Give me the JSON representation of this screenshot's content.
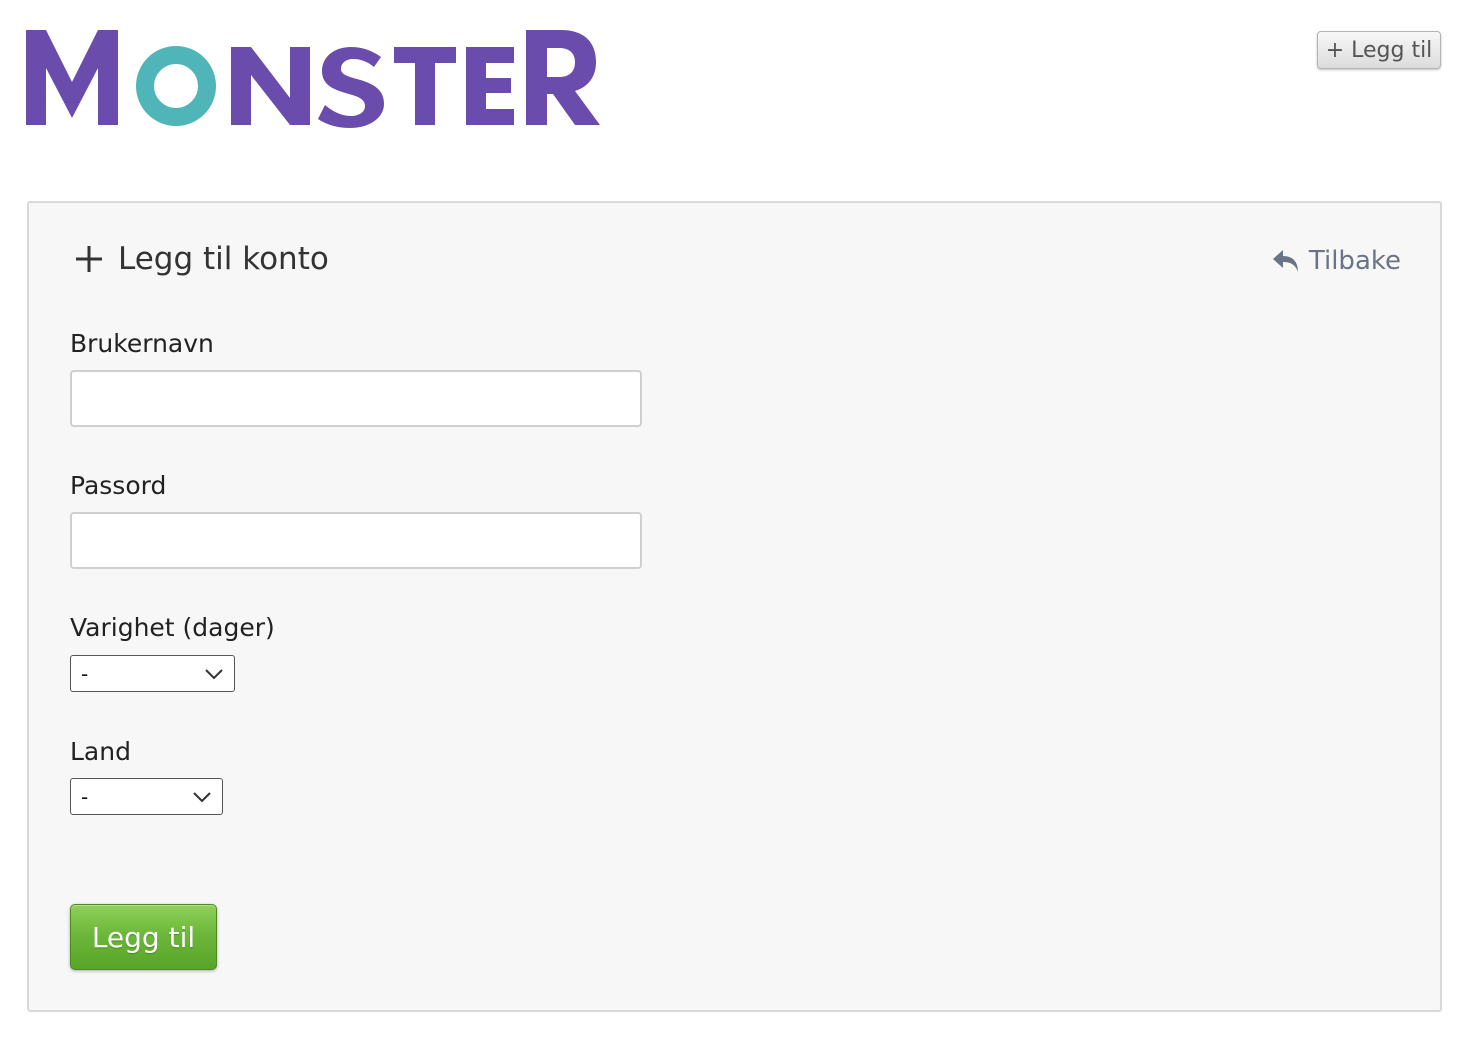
{
  "brand": {
    "logo_text": "MONSTER",
    "primary_color": "#6a4cad",
    "accent_color": "#50b5b8"
  },
  "header": {
    "add_button": {
      "icon": "plus-icon",
      "label": "+ Legg til"
    }
  },
  "panel": {
    "title": {
      "icon": "plus-icon",
      "text": "Legg til konto"
    },
    "back_link": {
      "icon": "reply-arrow-icon",
      "label": "Tilbake"
    },
    "fields": {
      "username": {
        "label": "Brukernavn",
        "value": "",
        "placeholder": ""
      },
      "password": {
        "label": "Passord",
        "value": "",
        "placeholder": ""
      },
      "duration": {
        "label": "Varighet (dager)",
        "selected": "-"
      },
      "country": {
        "label": "Land",
        "selected": "-"
      }
    },
    "submit": {
      "label": "Legg til",
      "color": "#6db83a"
    }
  }
}
